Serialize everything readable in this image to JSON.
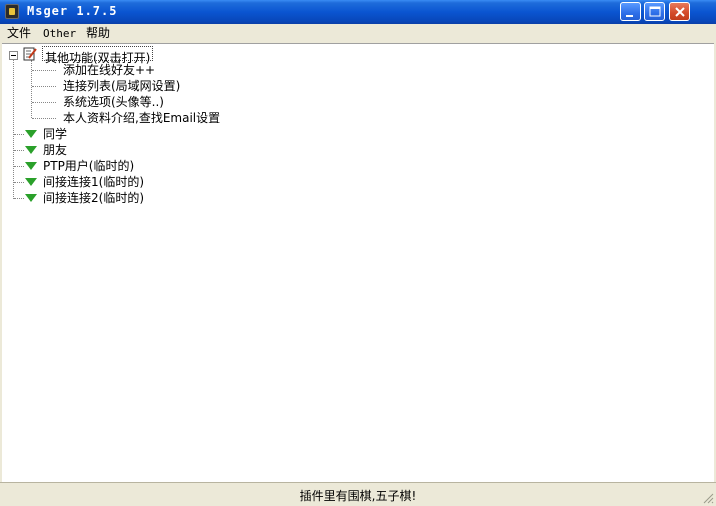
{
  "window": {
    "title": "Msger 1.7.5",
    "controls": [
      "minimize",
      "maximize",
      "close"
    ]
  },
  "menu": {
    "items": [
      {
        "label": "文件"
      },
      {
        "label": "Other"
      },
      {
        "label": "帮助"
      }
    ]
  },
  "tree": {
    "root": {
      "label": "其他功能(双击打开)",
      "icon": "notepad-pencil-icon",
      "expanded": true,
      "selected": true,
      "children": [
        {
          "label": "添加在线好友++"
        },
        {
          "label": "连接列表(局域网设置)"
        },
        {
          "label": "系统选项(头像等..)"
        },
        {
          "label": "本人资料介绍,查找Email设置"
        }
      ]
    },
    "groups": [
      {
        "label": "同学",
        "icon": "green-triangle-icon"
      },
      {
        "label": "朋友",
        "icon": "green-triangle-icon"
      },
      {
        "label": "PTP用户(临时的)",
        "icon": "green-triangle-icon"
      },
      {
        "label": "间接连接1(临时的)",
        "icon": "green-triangle-icon"
      },
      {
        "label": "间接连接2(临时的)",
        "icon": "green-triangle-icon"
      }
    ]
  },
  "status": {
    "text": "插件里有围棋,五子棋!"
  },
  "colors": {
    "titlebar": "#0a55d1",
    "group_icon": "#2aa02a",
    "chrome": "#ece9d8"
  }
}
